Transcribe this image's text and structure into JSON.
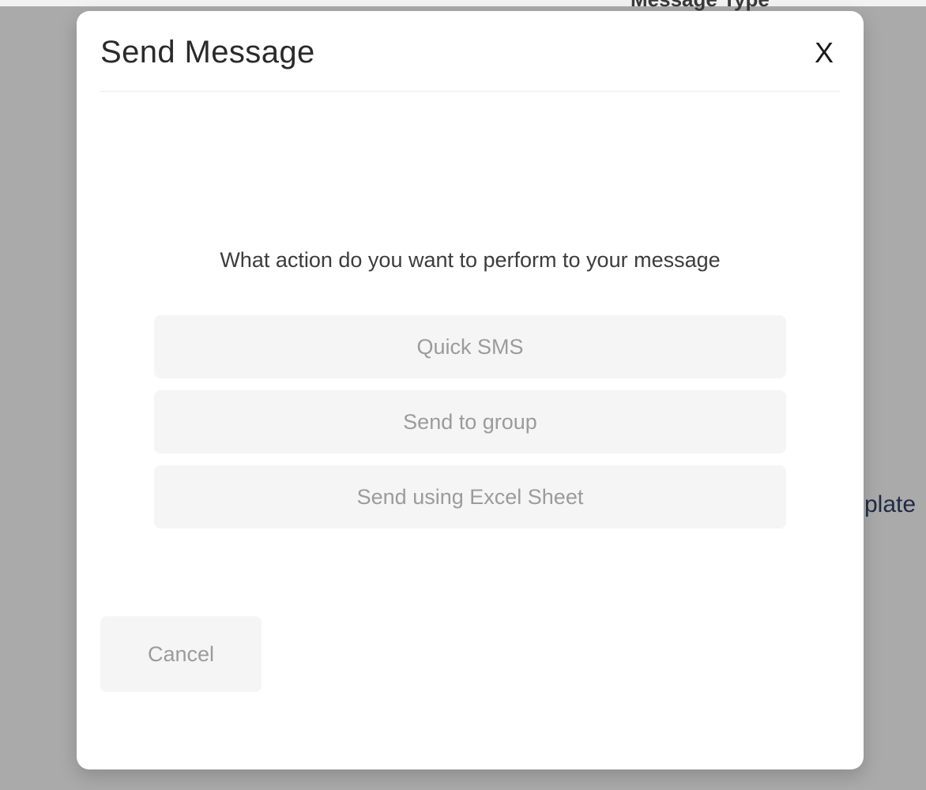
{
  "background": {
    "header_label": "Message Type",
    "template_label": "plate"
  },
  "modal": {
    "title": "Send Message",
    "close_label": "X",
    "prompt": "What action do you want to perform to your message",
    "options": [
      "Quick SMS",
      "Send to group",
      "Send using Excel Sheet"
    ],
    "cancel_label": "Cancel"
  }
}
